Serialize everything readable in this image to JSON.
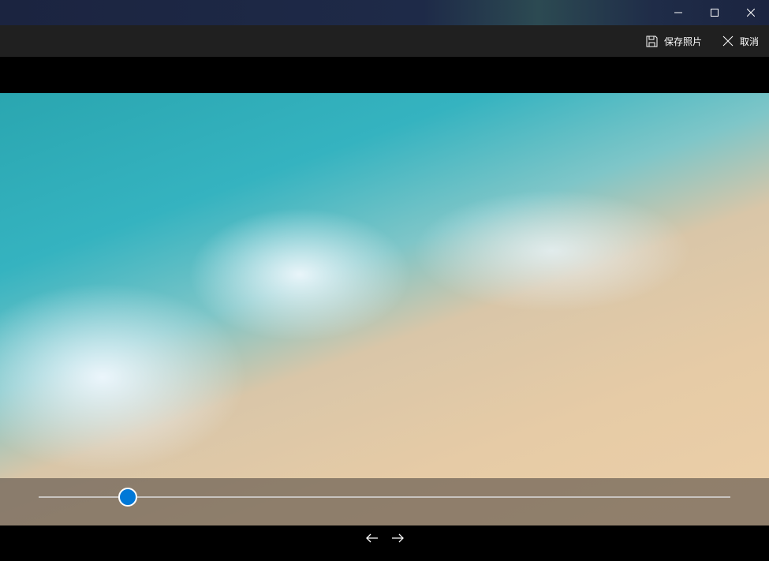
{
  "window": {
    "minimize": "minimize",
    "maximize": "maximize",
    "close": "close"
  },
  "toolbar": {
    "save_label": "保存照片",
    "cancel_label": "取消"
  },
  "slider": {
    "value_fraction": 0.129
  },
  "accent": "#0078d7"
}
